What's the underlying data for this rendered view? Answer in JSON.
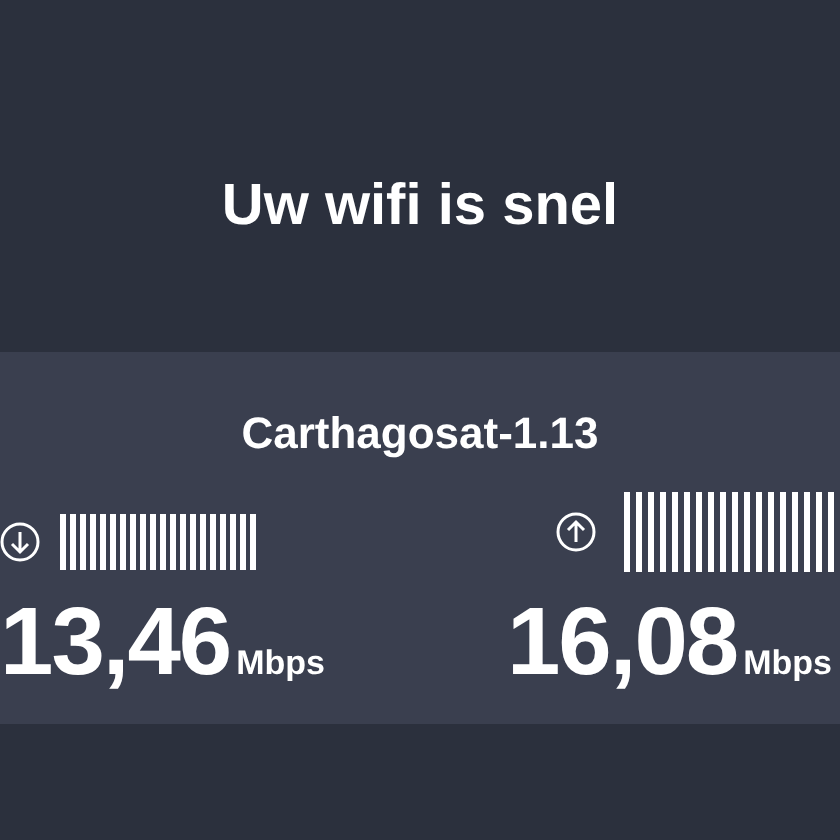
{
  "headline": "Uw wifi is snel",
  "network": {
    "name": "Carthagosat-1.13"
  },
  "speeds": [
    {
      "kind": "download",
      "value": "13,46",
      "unit": "Mbps"
    },
    {
      "kind": "upload",
      "value": "16,08",
      "unit": "Mbps"
    }
  ]
}
